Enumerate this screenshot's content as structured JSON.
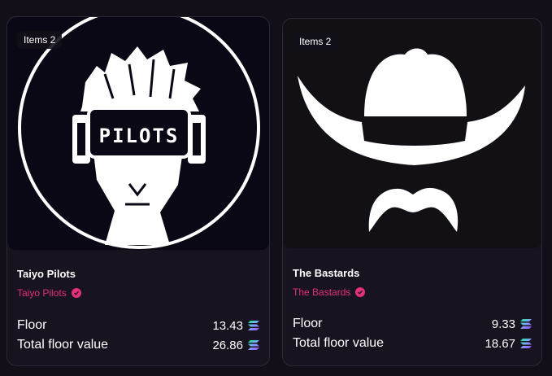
{
  "cards": [
    {
      "badge": "Items 2",
      "title": "Taiyo Pilots",
      "creator": "Taiyo Pilots",
      "logo_text": "PILOTS",
      "floor_label": "Floor",
      "floor_value": "13.43",
      "total_label": "Total floor value",
      "total_value": "26.86"
    },
    {
      "badge": "Items 2",
      "title": "The Bastards",
      "creator": "The Bastards",
      "floor_label": "Floor",
      "floor_value": "9.33",
      "total_label": "Total floor value",
      "total_value": "18.67"
    }
  ],
  "colors": {
    "accent": "#e6307a",
    "background": "#120f18",
    "card": "#17131f",
    "solana_gradient": [
      "#9945ff",
      "#14f195"
    ]
  },
  "icons": [
    "verified-badge-icon",
    "solana-icon"
  ]
}
